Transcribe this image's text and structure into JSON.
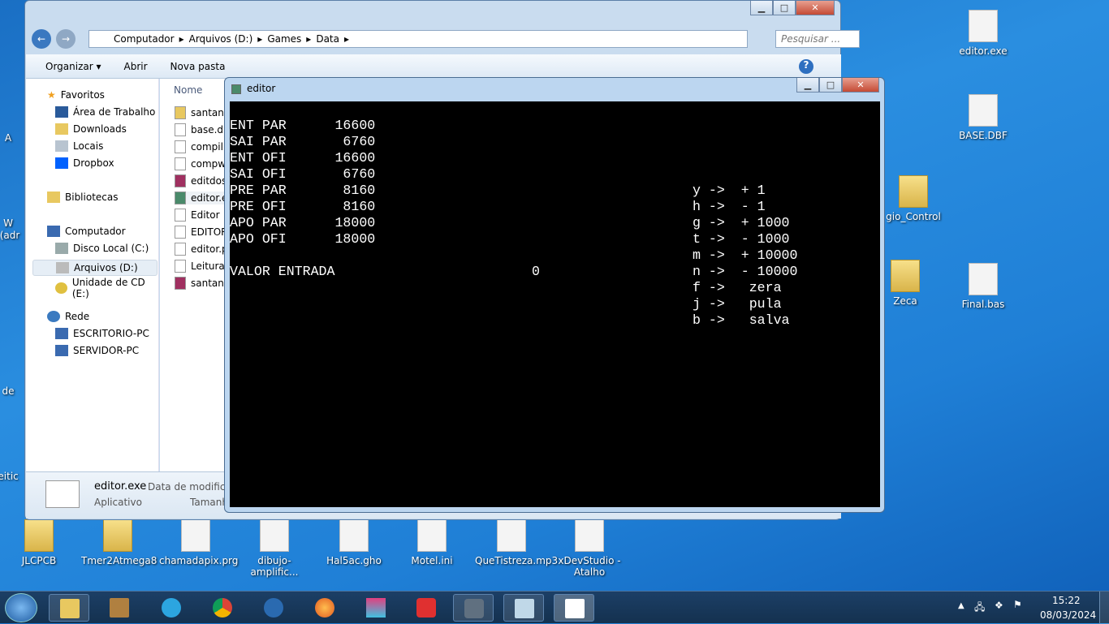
{
  "desktop": {
    "icons_right": [
      {
        "label": "editor.exe"
      },
      {
        "label": "BASE.DBF"
      },
      {
        "label": "gio_Control"
      },
      {
        "label": "Zeca"
      },
      {
        "label": "Final.bas"
      }
    ],
    "icons_bottom": [
      {
        "label": "JLCPCB"
      },
      {
        "label": "Tmer2Atmega8"
      },
      {
        "label": "chamadapix.prg"
      },
      {
        "label": "dibujo-amplific..."
      },
      {
        "label": "Hal5ac.gho"
      },
      {
        "label": "Motel.ini"
      },
      {
        "label": "QueTistreza.mp3"
      },
      {
        "label": "xDevStudio - Atalho"
      }
    ],
    "icons_left_fragments": [
      "A",
      "W",
      "(adr",
      "de",
      "feitic"
    ]
  },
  "explorer": {
    "breadcrumb": [
      "Computador",
      "Arquivos (D:)",
      "Games",
      "Data"
    ],
    "search_placeholder": "Pesquisar ...",
    "toolbar": {
      "organize": "Organizar ▾",
      "open": "Abrir",
      "new_folder": "Nova pasta"
    },
    "nav": {
      "favorites": "Favoritos",
      "fav_items": [
        "Área de Trabalho",
        "Downloads",
        "Locais",
        "Dropbox"
      ],
      "libraries": "Bibliotecas",
      "computer": "Computador",
      "computer_items": [
        "Disco Local (C:)",
        "Arquivos (D:)",
        "Unidade de CD (E:)"
      ],
      "network": "Rede",
      "network_items": [
        "ESCRITORIO-PC",
        "SERVIDOR-PC"
      ]
    },
    "column_name": "Nome",
    "files": [
      "santana",
      "base.db",
      "compil.",
      "compw",
      "editdos",
      "editor.e",
      "Editor",
      "EDITOR",
      "editor.p",
      "Leitura.",
      "santana"
    ],
    "details": {
      "name": "editor.exe",
      "type": "Aplicativo",
      "modified_label": "Data de modificaç",
      "size_label": "Tamanh"
    }
  },
  "editor": {
    "title": "editor",
    "left_lines": [
      "ENT PAR      16600",
      "SAI PAR       6760",
      "ENT OFI      16600",
      "SAI OFI       6760",
      "PRE PAR       8160",
      "PRE OFI       8160",
      "APO PAR      18000",
      "APO OFI      18000"
    ],
    "input_label": "VALOR ENTRADA",
    "input_value": "0",
    "keys": [
      "y ->  + 1",
      "h ->  - 1",
      "g ->  + 1000",
      "t ->  - 1000",
      "m ->  + 10000",
      "n ->  - 10000",
      "f ->   zera",
      "j ->   pula",
      "b ->   salva"
    ]
  },
  "taskbar": {
    "time": "15:22",
    "date": "08/03/2024"
  }
}
